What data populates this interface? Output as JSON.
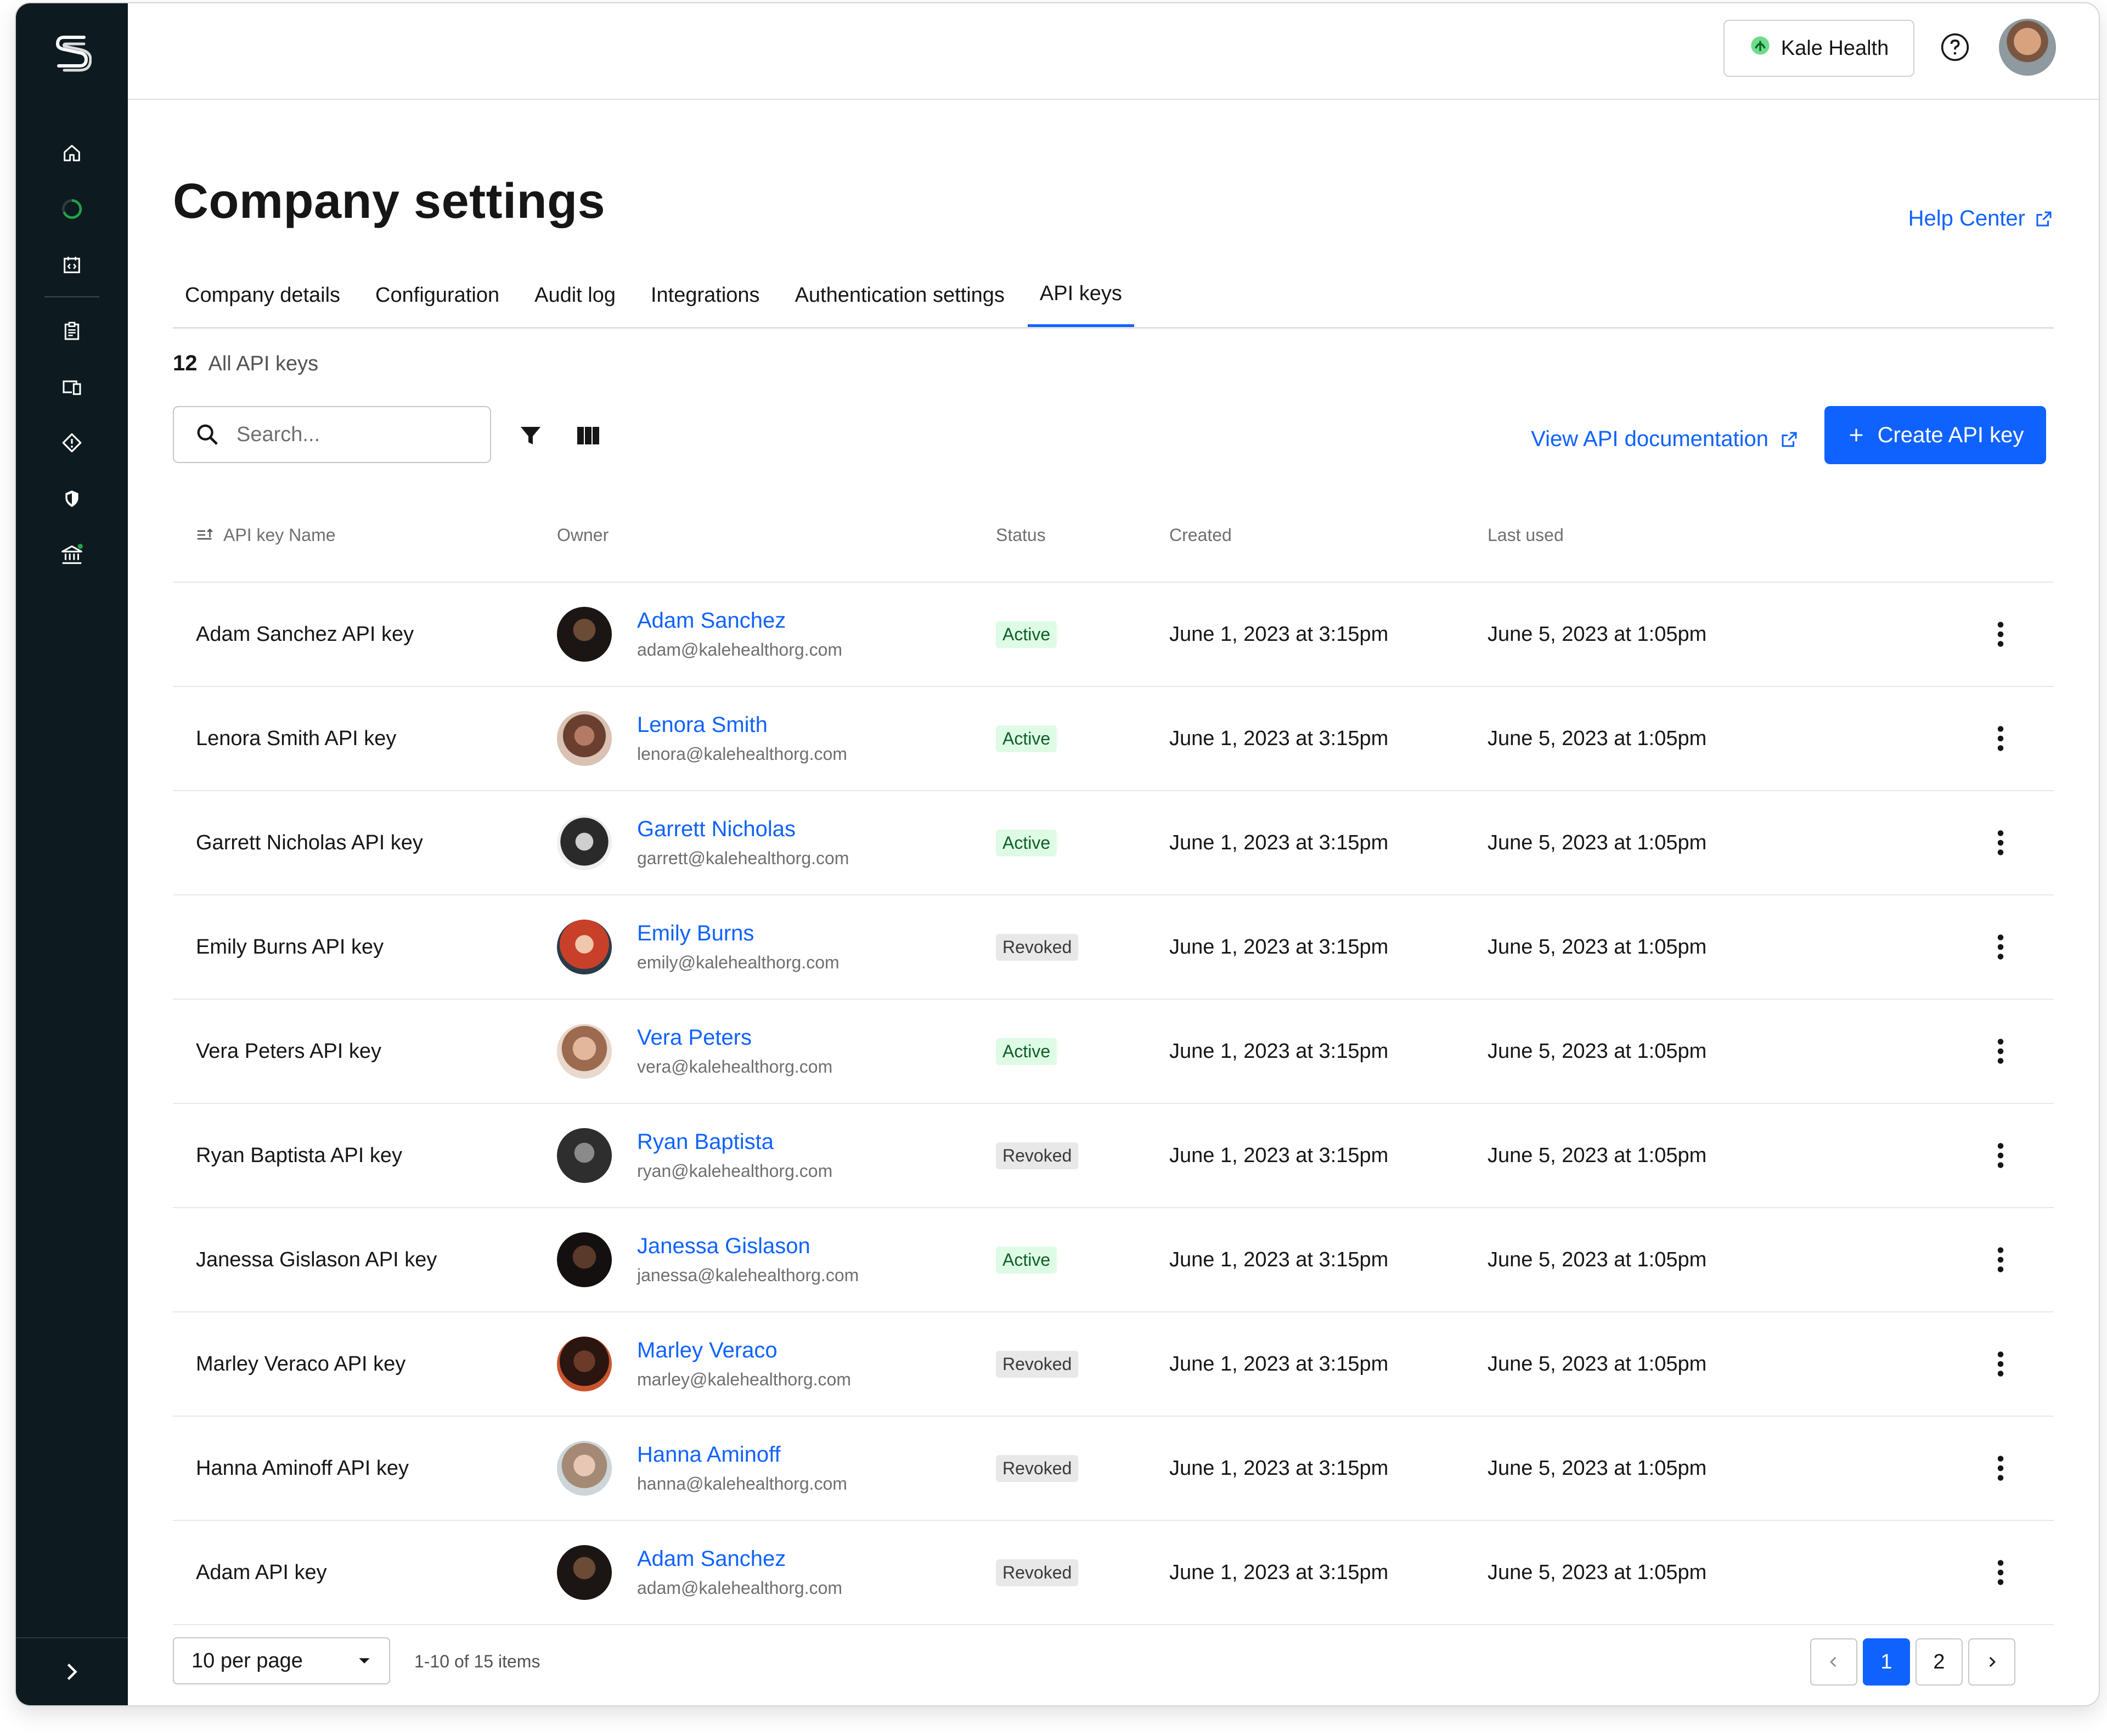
{
  "app": {
    "org_name": "Kale Health",
    "help_center": "Help Center"
  },
  "page": {
    "title": "Company settings"
  },
  "tabs": [
    {
      "label": "Company details"
    },
    {
      "label": "Configuration"
    },
    {
      "label": "Audit log"
    },
    {
      "label": "Integrations"
    },
    {
      "label": "Authentication settings"
    },
    {
      "label": "API keys",
      "active": true
    }
  ],
  "summary": {
    "count": "12",
    "label": "All API keys"
  },
  "toolbar": {
    "search_placeholder": "Search...",
    "view_docs": "View API documentation",
    "create_label": "Create API key"
  },
  "table": {
    "headers": {
      "name": "API key Name",
      "owner": "Owner",
      "status": "Status",
      "created": "Created",
      "last_used": "Last used"
    },
    "rows": [
      {
        "name": "Adam Sanchez API key",
        "owner": "Adam Sanchez",
        "email": "adam@kalehealthorg.com",
        "status": "Active",
        "created": "June 1, 2023 at 3:15pm",
        "last_used": "June 5, 2023 at 1:05pm"
      },
      {
        "name": "Lenora Smith API key",
        "owner": "Lenora Smith",
        "email": "lenora@kalehealthorg.com",
        "status": "Active",
        "created": "June 1, 2023 at 3:15pm",
        "last_used": "June 5, 2023 at 1:05pm"
      },
      {
        "name": "Garrett Nicholas API key",
        "owner": "Garrett Nicholas",
        "email": "garrett@kalehealthorg.com",
        "status": "Active",
        "created": "June 1, 2023 at 3:15pm",
        "last_used": "June 5, 2023 at 1:05pm"
      },
      {
        "name": "Emily Burns API key",
        "owner": "Emily Burns",
        "email": "emily@kalehealthorg.com",
        "status": "Revoked",
        "created": "June 1, 2023 at 3:15pm",
        "last_used": "June 5, 2023 at 1:05pm"
      },
      {
        "name": "Vera Peters API key",
        "owner": "Vera Peters",
        "email": "vera@kalehealthorg.com",
        "status": "Active",
        "created": "June 1, 2023 at 3:15pm",
        "last_used": "June 5, 2023 at 1:05pm"
      },
      {
        "name": "Ryan Baptista API key",
        "owner": "Ryan Baptista",
        "email": "ryan@kalehealthorg.com",
        "status": "Revoked",
        "created": "June 1, 2023 at 3:15pm",
        "last_used": "June 5, 2023 at 1:05pm"
      },
      {
        "name": "Janessa Gislason API key",
        "owner": "Janessa Gislason",
        "email": "janessa@kalehealthorg.com",
        "status": "Active",
        "created": "June 1, 2023 at 3:15pm",
        "last_used": "June 5, 2023 at 1:05pm"
      },
      {
        "name": "Marley Veraco API key",
        "owner": "Marley Veraco",
        "email": "marley@kalehealthorg.com",
        "status": "Revoked",
        "created": "June 1, 2023 at 3:15pm",
        "last_used": "June 5, 2023 at 1:05pm"
      },
      {
        "name": "Hanna Aminoff API key",
        "owner": "Hanna Aminoff",
        "email": "hanna@kalehealthorg.com",
        "status": "Revoked",
        "created": "June 1, 2023 at 3:15pm",
        "last_used": "June 5, 2023 at 1:05pm"
      },
      {
        "name": "Adam API key",
        "owner": "Adam Sanchez",
        "email": "adam@kalehealthorg.com",
        "status": "Revoked",
        "created": "June 1, 2023 at 3:15pm",
        "last_used": "June 5, 2023 at 1:05pm"
      }
    ]
  },
  "pagination": {
    "per_page": "10 per page",
    "range": "1-10 of 15 items",
    "pages": [
      "1",
      "2"
    ],
    "current": "1"
  },
  "colors": {
    "sidebar": "#0d1b20",
    "accent": "#0f62fe",
    "active_bg": "#defbe6",
    "active_text": "#0e6027",
    "revoked_bg": "#e8e8e8",
    "notification_dot": "#24a148"
  },
  "icons": {
    "sidebar": [
      "logo-icon",
      "home-icon",
      "progress-icon",
      "code-calendar-icon",
      "clipboard-icon",
      "devices-icon",
      "diamond-alert-icon",
      "shield-icon",
      "bank-icon"
    ],
    "toolbar": [
      "search-icon",
      "filter-icon",
      "columns-icon",
      "external-link-icon",
      "plus-icon"
    ],
    "row": [
      "overflow-menu-icon"
    ]
  }
}
